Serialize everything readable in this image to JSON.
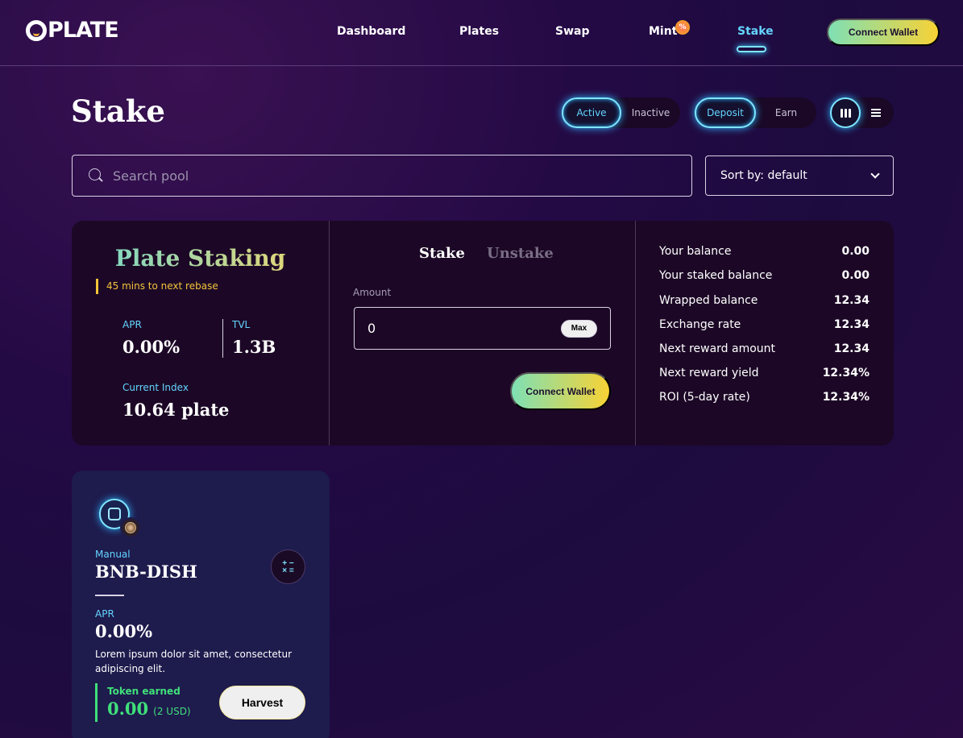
{
  "app": {
    "logo_text": "PLATE"
  },
  "nav": {
    "items": [
      {
        "label": "Dashboard"
      },
      {
        "label": "Plates"
      },
      {
        "label": "Swap"
      },
      {
        "label": "Mint"
      },
      {
        "label": "Stake"
      }
    ],
    "active": "Stake",
    "mint_badge": "%",
    "connect_wallet": "Connect Wallet"
  },
  "page": {
    "title": "Stake",
    "status_filter": {
      "active": "Active",
      "inactive": "Inactive",
      "selected": "Active"
    },
    "mode_filter": {
      "deposit": "Deposit",
      "earn": "Earn",
      "selected": "Deposit"
    },
    "view_mode": "grid"
  },
  "search": {
    "placeholder": "Search pool",
    "value": ""
  },
  "sort": {
    "label": "Sort by: default"
  },
  "staking": {
    "title": "Plate Staking",
    "rebase": "45 mins to next rebase",
    "apr_label": "APR",
    "apr": "0.00%",
    "tvl_label": "TVL",
    "tvl": "1.3B",
    "index_label": "Current Index",
    "index": "10.64 plate",
    "tabs": {
      "stake": "Stake",
      "unstake": "Unstake",
      "selected": "Stake"
    },
    "amount_label": "Amount",
    "amount_value": "0",
    "max_label": "Max",
    "connect_wallet": "Connect Wallet",
    "balances": [
      {
        "label": "Your balance",
        "value": "0.00"
      },
      {
        "label": "Your staked balance",
        "value": "0.00"
      },
      {
        "label": "Wrapped balance",
        "value": "12.34"
      },
      {
        "label": "Exchange rate",
        "value": "12.34"
      },
      {
        "label": "Next reward amount",
        "value": "12.34"
      },
      {
        "label": "Next reward yield",
        "value": "12.34%"
      },
      {
        "label": "ROI (5-day rate)",
        "value": "12.34%"
      }
    ]
  },
  "pool": {
    "type": "Manual",
    "name": "BNB-DISH",
    "calc_glyph": "+ −\n× =",
    "apr_label": "APR",
    "apr": "0.00%",
    "description": "Lorem ipsum dolor sit amet, consectetur adipiscing elit.",
    "earned_label": "Token earned",
    "earned_value": "0.00",
    "earned_usd": "(2 USD)",
    "harvest_label": "Harvest"
  },
  "colors": {
    "accent": "#64d4ff",
    "gold": "#f4c43a",
    "green": "#3fe07a",
    "button_gradient_start": "#7ee0b5",
    "button_gradient_end": "#f8d235"
  }
}
